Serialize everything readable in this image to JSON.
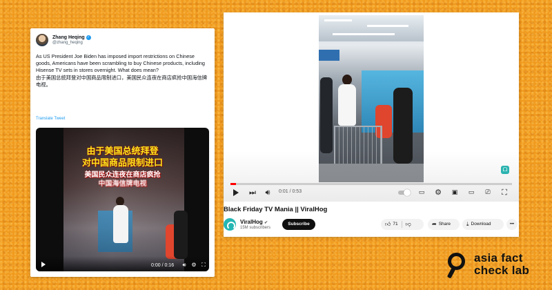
{
  "tweet": {
    "author_name": "Zhang Heqing",
    "author_handle": "@zhang_heqing",
    "text_en": "As US President Joe Biden has imposed import restrictions on Chinese goods, Americans have been scrambling to buy Chinese products, including Hisense TV sets in stores overnight. What does mean?",
    "text_zh": "由于美国总统拜登对中国商品限制进口，美国民众连夜在商店疯抢中国海信牌电视。",
    "translate_link": "Translate Tweet",
    "video": {
      "overlay_line1": "由于美国总统拜登",
      "overlay_line2": "对中国商品限制进口",
      "overlay_line3": "美国民众连夜在商店疯抢",
      "overlay_line4": "中国海信牌电视",
      "time": "0:00 / 0:16",
      "progress": 0.0
    }
  },
  "youtube": {
    "video_title": "Black Friday TV Mania || ViralHog",
    "time": "0:01 / 0:53",
    "progress": 0.02,
    "channel_name": "ViralHog",
    "subscribers": "15M subscribers",
    "subscribe_label": "Subscribe",
    "like_count": "71",
    "share_label": "Share",
    "download_label": "Download",
    "more_label": "•••"
  },
  "logo": {
    "line1": "asia fact",
    "line2": "check lab"
  },
  "colors": {
    "background": "#f09a1e",
    "twitter_blue": "#1d9bf0",
    "youtube_red": "#ff0000",
    "viralhog_teal": "#24b6b3"
  }
}
